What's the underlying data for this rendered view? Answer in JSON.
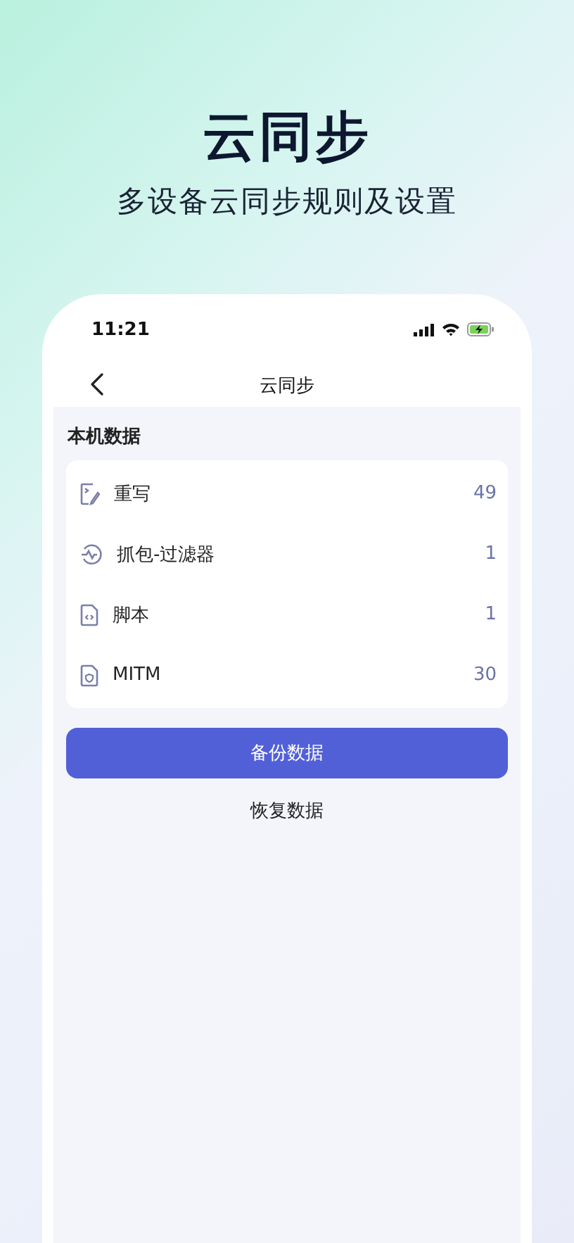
{
  "headline": "云同步",
  "subheadline": "多设备云同步规则及设置",
  "status_bar": {
    "time": "11:21"
  },
  "nav": {
    "title": "云同步"
  },
  "section": {
    "title": "本机数据"
  },
  "items": [
    {
      "kind": "rewrite",
      "label": "重写",
      "count": "49"
    },
    {
      "kind": "filter",
      "label": "抓包-过滤器",
      "count": "1"
    },
    {
      "kind": "script",
      "label": "脚本",
      "count": "1"
    },
    {
      "kind": "mitm",
      "label": "MITM",
      "count": "30"
    }
  ],
  "primary_button": "备份数据",
  "secondary_button": "恢复数据"
}
